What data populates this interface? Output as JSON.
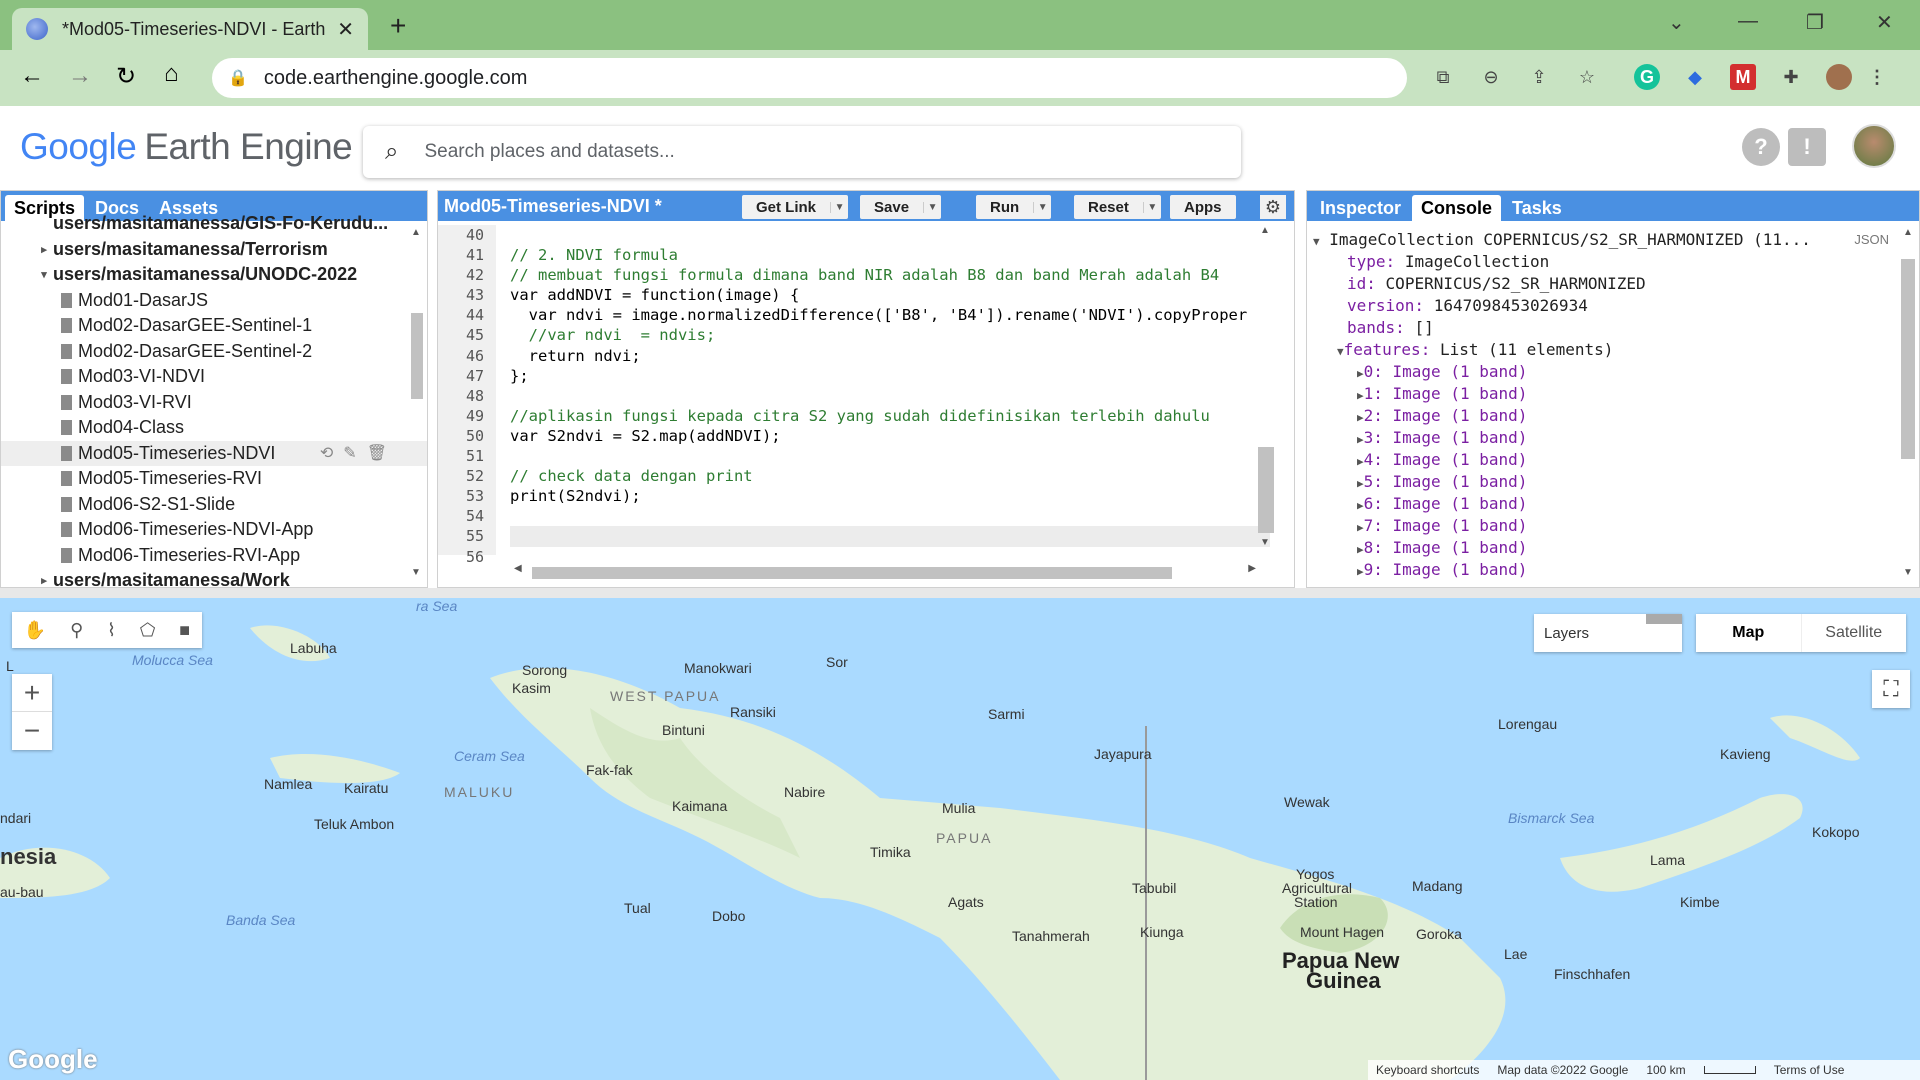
{
  "browser": {
    "tab_title": "*Mod05-Timeseries-NDVI - Earth",
    "new_tab": "+",
    "url": "code.earthengine.google.com",
    "window_controls": [
      "⌄",
      "—",
      "❐",
      "✕"
    ]
  },
  "header": {
    "logo_google": "Google",
    "logo_product": "Earth Engine",
    "search_placeholder": "Search places and datasets..."
  },
  "left_panel": {
    "tabs": [
      "Scripts",
      "Docs",
      "Assets"
    ],
    "tree": [
      {
        "label": "users/masitamanessa/GIS-Fo-Kerudu...",
        "bold": true,
        "arrow": ""
      },
      {
        "label": "users/masitamanessa/Terrorism",
        "bold": true,
        "arrow": "▸"
      },
      {
        "label": "users/masitamanessa/UNODC-2022",
        "bold": true,
        "arrow": "▾"
      },
      {
        "label": "Mod01-DasarJS",
        "file": true
      },
      {
        "label": "Mod02-DasarGEE-Sentinel-1",
        "file": true
      },
      {
        "label": "Mod02-DasarGEE-Sentinel-2",
        "file": true
      },
      {
        "label": "Mod03-VI-NDVI",
        "file": true
      },
      {
        "label": "Mod03-VI-RVI",
        "file": true
      },
      {
        "label": "Mod04-Class",
        "file": true
      },
      {
        "label": "Mod05-Timeseries-NDVI",
        "file": true,
        "selected": true
      },
      {
        "label": "Mod05-Timeseries-RVI",
        "file": true
      },
      {
        "label": "Mod06-S2-S1-Slide",
        "file": true
      },
      {
        "label": "Mod06-Timeseries-NDVI-App",
        "file": true
      },
      {
        "label": "Mod06-Timeseries-RVI-App",
        "file": true
      },
      {
        "label": "users/masitamanessa/Work",
        "bold": true,
        "arrow": "▸"
      }
    ]
  },
  "editor": {
    "script_title": "Mod05-Timeseries-NDVI *",
    "buttons": {
      "get_link": "Get Link",
      "save": "Save",
      "run": "Run",
      "reset": "Reset",
      "apps": "Apps"
    },
    "line_numbers": [
      "40",
      "41",
      "42",
      "43",
      "44",
      "45",
      "46",
      "47",
      "48",
      "49",
      "50",
      "51",
      "52",
      "53",
      "54",
      "55",
      "56"
    ],
    "lines": [
      "",
      "// 2. NDVI formula",
      "// membuat fungsi formula dimana band NIR adalah B8 dan band Merah adalah B4",
      "var addNDVI = function(image) {",
      "  var ndvi = image.normalizedDifference(['B8', 'B4']).rename('NDVI').copyProper",
      "  //var ndvi  = ndvis;",
      "  return ndvi;",
      "};",
      "",
      "//aplikasin fungsi kepada citra S2 yang sudah didefinisikan terlebih dahulu",
      "var S2ndvi = S2.map(addNDVI);",
      "",
      "// check data dengan print",
      "print(S2ndvi);",
      "",
      "",
      ""
    ]
  },
  "right_panel": {
    "tabs": [
      "Inspector",
      "Console",
      "Tasks"
    ],
    "header": "ImageCollection COPERNICUS/S2_SR_HARMONIZED (11...",
    "json_label": "JSON",
    "props": [
      {
        "k": "type:",
        "v": "ImageCollection"
      },
      {
        "k": "id:",
        "v": "COPERNICUS/S2_SR_HARMONIZED"
      },
      {
        "k": "version:",
        "v": "1647098453026934"
      },
      {
        "k": "bands:",
        "v": "[]"
      }
    ],
    "features": {
      "k": "features:",
      "v": "List (11 elements)"
    },
    "feature_items": [
      "0: Image (1 band)",
      "1: Image (1 band)",
      "2: Image (1 band)",
      "3: Image (1 band)",
      "4: Image (1 band)",
      "5: Image (1 band)",
      "6: Image (1 band)",
      "7: Image (1 band)",
      "8: Image (1 band)",
      "9: Image (1 band)"
    ]
  },
  "map": {
    "layers_label": "Layers",
    "map_btn": "Map",
    "satellite_btn": "Satellite",
    "zoom_in": "+",
    "zoom_out": "−",
    "attribution": {
      "shortcuts": "Keyboard shortcuts",
      "data": "Map data ©2022 Google",
      "scale": "100 km",
      "terms": "Terms of Use"
    },
    "google": "Google",
    "labels": [
      {
        "t": "Molucca Sea",
        "sea": true
      },
      {
        "t": "Labuha"
      },
      {
        "t": "Sorong"
      },
      {
        "t": "Manokwari"
      },
      {
        "t": "Sor"
      },
      {
        "t": "Kasim"
      },
      {
        "t": "WEST PAPUA"
      },
      {
        "t": "Ransiki"
      },
      {
        "t": "Bintuni"
      },
      {
        "t": "Sarmi"
      },
      {
        "t": "Lorengau"
      },
      {
        "t": "Ceram Sea",
        "sea": true
      },
      {
        "t": "Jayapura"
      },
      {
        "t": "Kavieng"
      },
      {
        "t": "Fak-fak"
      },
      {
        "t": "Namlea"
      },
      {
        "t": "Kairatu"
      },
      {
        "t": "MALUKU"
      },
      {
        "t": "Nabire"
      },
      {
        "t": "Kaimana"
      },
      {
        "t": "Mulia"
      },
      {
        "t": "Wewak"
      },
      {
        "t": "Teluk Ambon"
      },
      {
        "t": "Bismarck Sea",
        "sea": true
      },
      {
        "t": "Kokopo"
      },
      {
        "t": "ndari"
      },
      {
        "t": "nesia"
      },
      {
        "t": "Timika"
      },
      {
        "t": "PAPUA"
      },
      {
        "t": "Lama"
      },
      {
        "t": "Yogos"
      },
      {
        "t": "Agricultural"
      },
      {
        "t": "Station"
      },
      {
        "t": "Madang"
      },
      {
        "t": "au-bau"
      },
      {
        "t": "Tabubil"
      },
      {
        "t": "Agats"
      },
      {
        "t": "Kimbe"
      },
      {
        "t": "Banda Sea",
        "sea": true
      },
      {
        "t": "Tual"
      },
      {
        "t": "Dobo"
      },
      {
        "t": "Mount Hagen"
      },
      {
        "t": "Goroka"
      },
      {
        "t": "Tanahmerah"
      },
      {
        "t": "Kiunga"
      },
      {
        "t": "Papua New"
      },
      {
        "t": "Guinea"
      },
      {
        "t": "Lae"
      },
      {
        "t": "Finschhafen"
      },
      {
        "t": "ra Sea",
        "sea": true
      },
      {
        "t": "L"
      }
    ]
  }
}
